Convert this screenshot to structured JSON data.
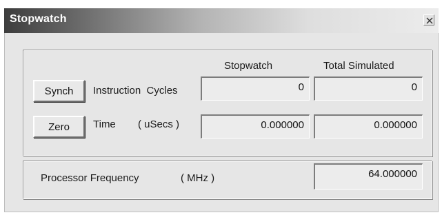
{
  "window": {
    "title": "Stopwatch"
  },
  "buttons": {
    "synch_label": "Synch",
    "zero_label": "Zero"
  },
  "columns": {
    "stopwatch_header": "Stopwatch",
    "total_simulated_header": "Total Simulated"
  },
  "rows": {
    "instruction_cycles": {
      "label": "Instruction  Cycles",
      "stopwatch_value": "0",
      "total_value": "0"
    },
    "time": {
      "label": "Time",
      "unit": "( uSecs )",
      "stopwatch_value": "0.000000",
      "total_value": "0.000000"
    }
  },
  "processor": {
    "label": "Processor Frequency",
    "unit": "( MHz )",
    "value": "64.000000"
  },
  "icons": {
    "close": "close-icon"
  }
}
